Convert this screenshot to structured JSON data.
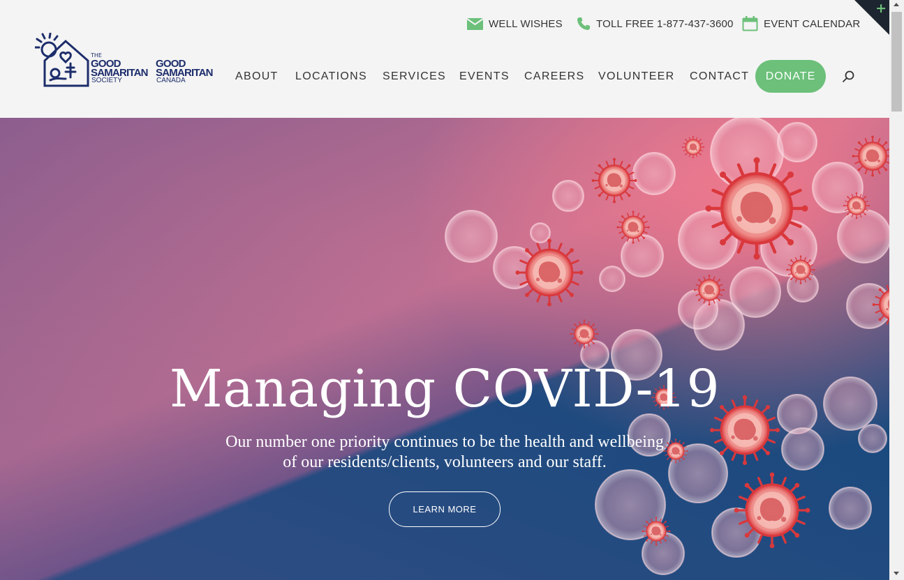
{
  "topbar": {
    "well_wishes": "WELL WISHES",
    "toll_free": "TOLL FREE 1-877-437-3600",
    "event_calendar": "EVENT CALENDAR"
  },
  "logo": {
    "the": "THE",
    "good_samaritan_1": "GOOD SAMARITAN",
    "society": "SOCIETY",
    "good_samaritan_2": "GOOD SAMARITAN",
    "canada": "CANADA"
  },
  "nav": {
    "about": "ABOUT",
    "locations": "LOCATIONS",
    "services": "SERVICES",
    "events": "EVENTS",
    "careers": "CAREERS",
    "volunteer": "VOLUNTEER",
    "contact": "CONTACT",
    "donate": "DONATE"
  },
  "hero": {
    "title": "Managing COVID-19",
    "subtitle_line1": "Our number one priority continues to be the health and wellbeing",
    "subtitle_line2": "of our residents/clients, volunteers and our staff.",
    "button": "LEARN MORE"
  },
  "colors": {
    "accent_green": "#6cc07a",
    "brand_navy": "#1d2d6b",
    "hero_blue": "#1a4a7e",
    "hero_pink": "#f47a8c",
    "virus_red": "#d9383c"
  },
  "icons": [
    "envelope-icon",
    "phone-icon",
    "calendar-icon",
    "search-icon",
    "plus-icon"
  ]
}
